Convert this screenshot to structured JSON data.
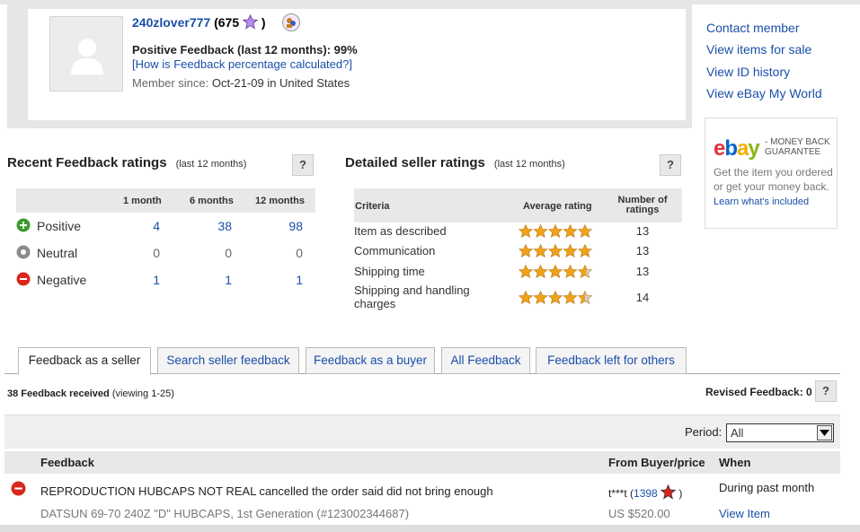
{
  "profile": {
    "username": "240zlover777",
    "score_open": "(",
    "score": "675",
    "score_close": ")",
    "positive_label": "Positive Feedback (last 12 months): 99%",
    "how_link": "[How is Feedback percentage calculated?]",
    "member_label": "Member since:",
    "member_since": "Oct-21-09",
    "location": "in United States"
  },
  "side_links": [
    "Contact member",
    "View items for sale",
    "View ID history",
    "View eBay My World"
  ],
  "mbg": {
    "logo": [
      "e",
      "b",
      "a",
      "y"
    ],
    "guarantee_line1": "- MONEY BACK",
    "guarantee_line2": "GUARANTEE",
    "desc": "Get the item you ordered or get your money back.",
    "learn": "Learn what's included"
  },
  "recent": {
    "title": "Recent Feedback ratings",
    "sub": "(last 12 months)",
    "help": "?",
    "cols": [
      "1 month",
      "6 months",
      "12 months"
    ],
    "rows": [
      {
        "label": "Positive",
        "values": [
          "4",
          "38",
          "98"
        ],
        "color": "#3c9a2e"
      },
      {
        "label": "Neutral",
        "values": [
          "0",
          "0",
          "0"
        ],
        "color": "#8c8c8c"
      },
      {
        "label": "Negative",
        "values": [
          "1",
          "1",
          "1"
        ],
        "color": "#d9281c"
      }
    ]
  },
  "detailed": {
    "title": "Detailed seller ratings",
    "sub": "(last 12 months)",
    "help": "?",
    "col_criteria": "Criteria",
    "col_avg": "Average rating",
    "col_num": "Number of ratings",
    "rows": [
      {
        "criteria": "Item as described",
        "rating": 4.8,
        "count": "13"
      },
      {
        "criteria": "Communication",
        "rating": 4.8,
        "count": "13"
      },
      {
        "criteria": "Shipping time",
        "rating": 4.6,
        "count": "13"
      },
      {
        "criteria": "Shipping and handling charges",
        "rating": 4.5,
        "count": "14"
      }
    ]
  },
  "tabs": [
    "Feedback as a seller",
    "Search seller feedback",
    "Feedback as a buyer",
    "All Feedback",
    "Feedback left for others"
  ],
  "feedback_count": {
    "bold": "38 Feedback received",
    "rest": "(viewing 1-25)"
  },
  "revised": "Revised Feedback: 0",
  "revised_help": "?",
  "period": {
    "label": "Period:",
    "value": "All"
  },
  "table": {
    "headers": [
      "Feedback",
      "From Buyer/price",
      "When"
    ],
    "rows": [
      {
        "comment": "REPRODUCTION HUBCAPS NOT REAL cancelled the order said did not bring enough",
        "item": "DATSUN 69-70 240Z \"D\" HUBCAPS, 1st Generation (#123002344687)",
        "buyer": "t***t",
        "buyer_score_open": "(",
        "buyer_score": "1398",
        "buyer_score_close": ")",
        "price": "US $520.00",
        "when": "During past month",
        "view": "View Item"
      }
    ]
  },
  "colors": {
    "link": "#1a4fa8",
    "star": "#f0a21a",
    "panel": "#e8e8e8"
  }
}
